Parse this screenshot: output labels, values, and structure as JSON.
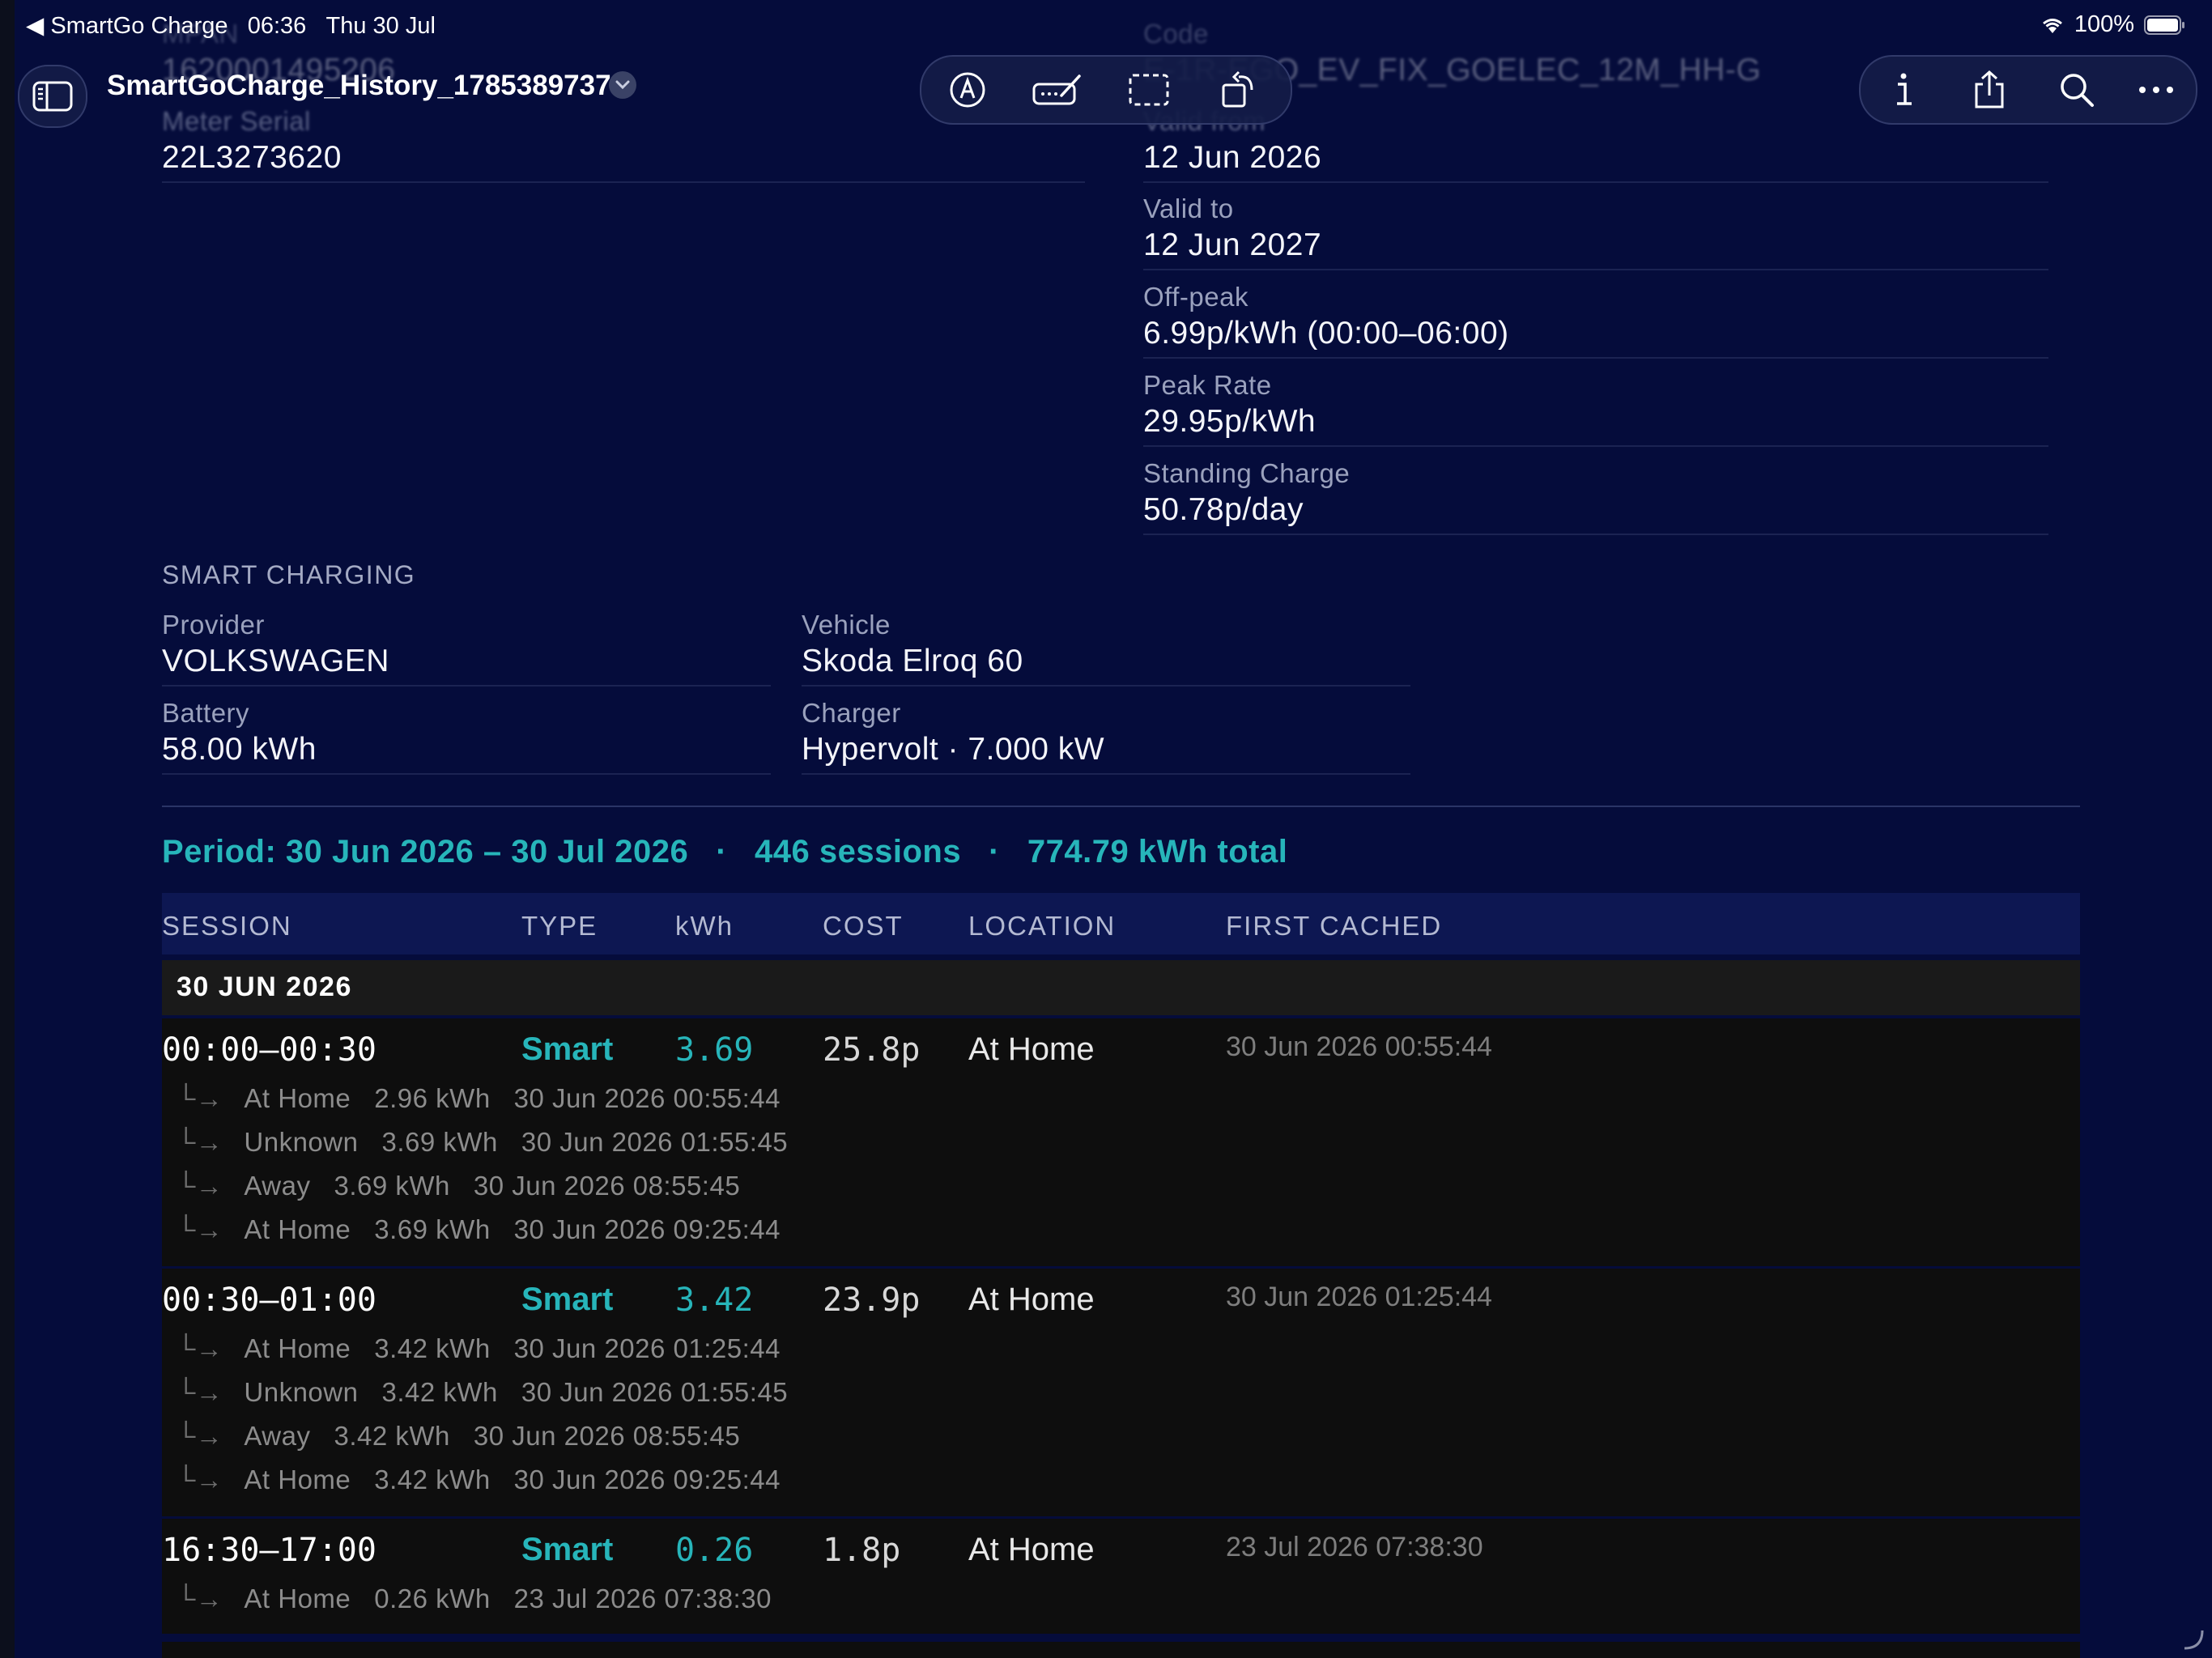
{
  "status_bar": {
    "back_label": "◀ SmartGo Charge",
    "time": "06:36",
    "date": "Thu 30 Jul",
    "battery": "100%"
  },
  "toolbar": {
    "doc_title": "SmartGoCharge_History_1785389737"
  },
  "meter": {
    "mpan_label": "MPAN",
    "mpan_value": "1620001495206",
    "serial_label": "Meter Serial",
    "serial_value": "22L3273620"
  },
  "tariff": {
    "code_label": "Code",
    "code_value": "E-1R-EGO_EV_FIX_GOELEC_12M_HH-G",
    "valid_from_label": "Valid from",
    "valid_from_value": "12 Jun 2026",
    "valid_to_label": "Valid to",
    "valid_to_value": "12 Jun 2027",
    "offpeak_label": "Off-peak",
    "offpeak_value": "6.99p/kWh (00:00–06:00)",
    "peak_label": "Peak Rate",
    "peak_value": "29.95p/kWh",
    "standing_label": "Standing Charge",
    "standing_value": "50.78p/day"
  },
  "smart_charging": {
    "section_title": "SMART CHARGING",
    "provider_label": "Provider",
    "provider_value": "VOLKSWAGEN",
    "vehicle_label": "Vehicle",
    "vehicle_value": "Skoda Elroq 60",
    "battery_label": "Battery",
    "battery_value": "58.00 kWh",
    "charger_label": "Charger",
    "charger_value": "Hypervolt · 7.000 kW"
  },
  "period": {
    "range": "Period: 30 Jun 2026 – 30 Jul 2026",
    "sessions": "446 sessions",
    "total": "774.79 kWh total",
    "separator": "·"
  },
  "table": {
    "headers": [
      "SESSION",
      "TYPE",
      "kWh",
      "COST",
      "LOCATION",
      "FIRST CACHED"
    ],
    "day_label": "30 JUN 2026",
    "sessions": [
      {
        "time": "00:00–00:30",
        "type": "Smart",
        "kwh": "3.69",
        "cost": "25.8p",
        "location": "At Home",
        "first_cached": "30 Jun 2026 00:55:44",
        "history": [
          "At Home   2.96 kWh   30 Jun 2026 00:55:44",
          "Unknown   3.69 kWh   30 Jun 2026 01:55:45",
          "Away   3.69 kWh   30 Jun 2026 08:55:45",
          "At Home   3.69 kWh   30 Jun 2026 09:25:44"
        ]
      },
      {
        "time": "00:30–01:00",
        "type": "Smart",
        "kwh": "3.42",
        "cost": "23.9p",
        "location": "At Home",
        "first_cached": "30 Jun 2026 01:25:44",
        "history": [
          "At Home   3.42 kWh   30 Jun 2026 01:25:44",
          "Unknown   3.42 kWh   30 Jun 2026 01:55:45",
          "Away   3.42 kWh   30 Jun 2026 08:55:45",
          "At Home   3.42 kWh   30 Jun 2026 09:25:44"
        ]
      },
      {
        "time": "16:30–17:00",
        "type": "Smart",
        "kwh": "0.26",
        "cost": "1.8p",
        "location": "At Home",
        "first_cached": "23 Jul 2026 07:38:30",
        "history": [
          "At Home   0.26 kWh   23 Jul 2026 07:38:30"
        ]
      }
    ]
  },
  "icons": {
    "sidebar": "sidebar-toggle-icon",
    "markup": "markup-pen-icon",
    "signature": "signature-icon",
    "selection": "selection-rect-icon",
    "rotate": "rotate-icon",
    "info": "info-icon",
    "share": "share-icon",
    "search": "search-icon",
    "more": "more-icon"
  },
  "colors": {
    "background": "#050c3b",
    "accent": "#27b5ba",
    "session_row": "#0e0e0e"
  }
}
